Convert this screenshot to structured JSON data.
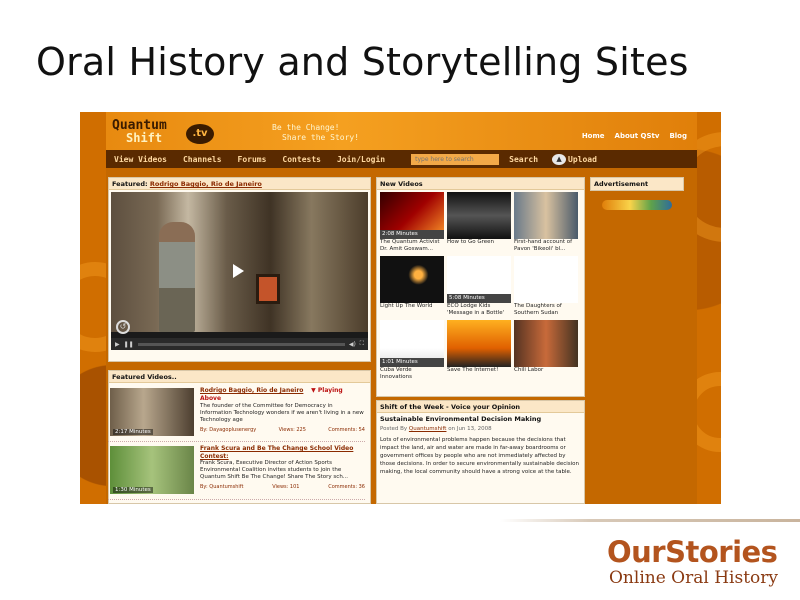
{
  "slide": {
    "title": "Oral History and Storytelling Sites"
  },
  "site": {
    "logo_line1": "Quantum",
    "logo_line2": "Shift",
    "logo_badge": ".tv",
    "tagline_line1": "Be the Change!",
    "tagline_line2": "Share the Story!",
    "top_links": [
      "Home",
      "About QStv",
      "Blog"
    ],
    "nav": [
      "View Videos",
      "Channels",
      "Forums",
      "Contests",
      "Join/Login"
    ],
    "search_placeholder": "type here to search",
    "search_label": "Search",
    "upload_label": "Upload"
  },
  "featured": {
    "head_prefix": "Featured: ",
    "head_link": "Rodrigo Baggio, Rio de Janeiro"
  },
  "featured_videos": {
    "head": "Featured Videos..",
    "items": [
      {
        "title": "Rodrigo Baggio, Rio de Janeiro",
        "playing": "▼ Playing Above",
        "desc": "The founder of the Committee for Democracy in Information Technology wonders if we aren't living in a new Technology age",
        "time": "2:17 Minutes",
        "by": "By: Dayagoplusenergy",
        "views": "Views: 225",
        "comments": "Comments: 54"
      },
      {
        "title": "Frank Scura and Be The Change School Video",
        "subtitle": "Contest:",
        "desc": "Frank Scura, Executive Director of Action Sports Environmental Coalition invites students to join the Quantum Shift Be The Change! Share The Story sch...",
        "time": "1:30 Minutes",
        "by": "By: Quantumshift",
        "views": "Views: 101",
        "comments": "Comments: 36"
      }
    ]
  },
  "new_videos": {
    "head": "New Videos",
    "items": [
      {
        "caption": "The Quantum Activist Dr. Amit Goswam...",
        "time": "2:08 Minutes"
      },
      {
        "caption": "How to Go Green",
        "time": ""
      },
      {
        "caption": "First-hand account of Pavon 'Bikeoli' bl...",
        "time": ""
      },
      {
        "caption": "Light Up The World",
        "time": ""
      },
      {
        "caption": "ECO Lodge Kids 'Message in a Bottle'",
        "time": "5:08 Minutes"
      },
      {
        "caption": "The Daughters of Southern Sudan",
        "time": ""
      },
      {
        "caption": "Cuba Verde Innovations",
        "time": "1:01 Minutes"
      },
      {
        "caption": "Save The Internet!",
        "time": ""
      },
      {
        "caption": "Chili Labor",
        "time": ""
      }
    ]
  },
  "shift_of_week": {
    "head": "Shift of the Week - Voice your Opinion",
    "title": "Sustainable Environmental Decision Making",
    "posted_prefix": "Posted By ",
    "posted_by": "Quantumshift",
    "posted_date": " on Jun 13, 2008",
    "body": "Lots of environmental problems happen because the decisions that impact the land, air and water are made in far-away boardrooms or government offices by people who are not immediately affected by those decisions. In order to secure environmentally sustainable decision making, the local community should have a strong voice at the table."
  },
  "advertisement": {
    "head": "Advertisement"
  },
  "brand": {
    "name": "OurStories",
    "subtitle": "Online Oral History"
  }
}
